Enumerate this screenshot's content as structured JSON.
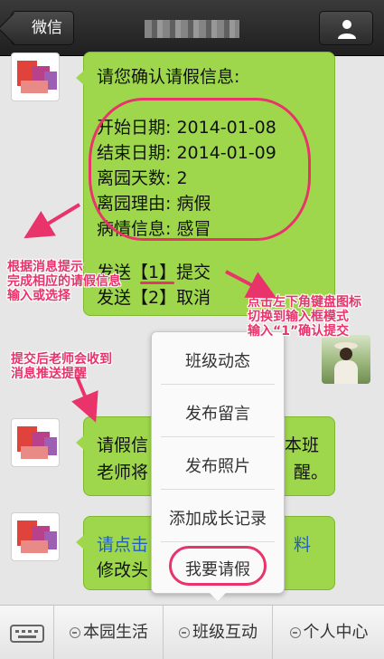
{
  "header": {
    "back_label": "微信"
  },
  "messages": {
    "confirm": {
      "title": "请您确认请假信息:",
      "fields": [
        "开始日期:  2014-01-08",
        "结束日期:  2014-01-09",
        "离园天数:  2",
        "离园理由:  病假",
        "病情信息:  感冒"
      ],
      "option1": "发送【1】提交",
      "option2": "发送【2】取消"
    },
    "second": {
      "line1_left": "请假信",
      "line1_right": "本班",
      "line2_left": "老师将",
      "line2_right": "醒。"
    },
    "third": {
      "line1_left": "请点击",
      "line1_right": "料",
      "line2_left": "修改头"
    }
  },
  "annotations": {
    "left_hint": [
      "根据消息提示",
      "完成相应的请假信息",
      "输入或选择"
    ],
    "right_hint": [
      "点击左下角键盘图标",
      "切换到输入框模式",
      "输入“1”确认提交"
    ],
    "teacher_hint": [
      "提交后老师会收到",
      "消息推送提醒"
    ]
  },
  "popup_menu": {
    "items": [
      "班级动态",
      "发布留言",
      "发布照片",
      "添加成长记录",
      "我要请假"
    ]
  },
  "bottom_bar": {
    "tabs": [
      "本园生活",
      "班级互动",
      "个人中心"
    ]
  },
  "colors": {
    "bubble": "#9fd74c",
    "annotation": "#e8336b",
    "link": "#1f5fc4"
  }
}
